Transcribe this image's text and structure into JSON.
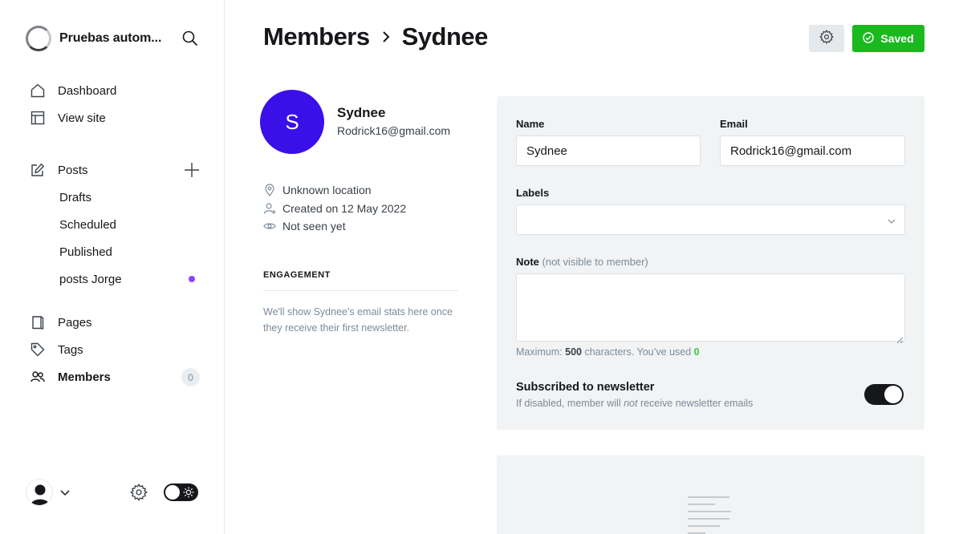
{
  "sidebar": {
    "site_title": "Pruebas autom...",
    "nav_main": [
      {
        "label": "Dashboard",
        "icon": "home-icon"
      },
      {
        "label": "View site",
        "icon": "view-site-icon"
      }
    ],
    "posts": {
      "label": "Posts",
      "icon": "edit-icon"
    },
    "posts_sub": [
      {
        "label": "Drafts"
      },
      {
        "label": "Scheduled"
      },
      {
        "label": "Published"
      },
      {
        "label": "posts Jorge"
      }
    ],
    "nav_bottom": [
      {
        "label": "Pages",
        "icon": "page-icon"
      },
      {
        "label": "Tags",
        "icon": "tag-icon"
      },
      {
        "label": "Members",
        "icon": "members-icon",
        "count": "0",
        "active": true
      }
    ],
    "dot_color": "#8e42ff"
  },
  "header": {
    "crumb_parent": "Members",
    "crumb_current": "Sydnee",
    "saved_label": "Saved",
    "saved_color": "#1aba1f"
  },
  "member": {
    "initial": "S",
    "name": "Sydnee",
    "email": "Rodrick16@gmail.com",
    "location": "Unknown location",
    "created": "Created on 12 May 2022",
    "seen": "Not seen yet",
    "avatar_color": "#3b0fe8"
  },
  "engagement": {
    "title": "ENGAGEMENT",
    "text": "We'll show Sydnee's email stats here once they receive their first newsletter."
  },
  "form": {
    "name_label": "Name",
    "name_value": "Sydnee",
    "email_label": "Email",
    "email_value": "Rodrick16@gmail.com",
    "labels_label": "Labels",
    "note_label": "Note",
    "note_muted": "(not visible to member)",
    "hint_prefix": "Maximum: ",
    "hint_max": "500",
    "hint_mid": " characters. You’ve used ",
    "hint_used": "0",
    "subscribed_title": "Subscribed to newsletter",
    "subscribed_desc_a": "If disabled, member will ",
    "subscribed_desc_em": "not",
    "subscribed_desc_b": " receive newsletter emails",
    "subscribed": true
  }
}
